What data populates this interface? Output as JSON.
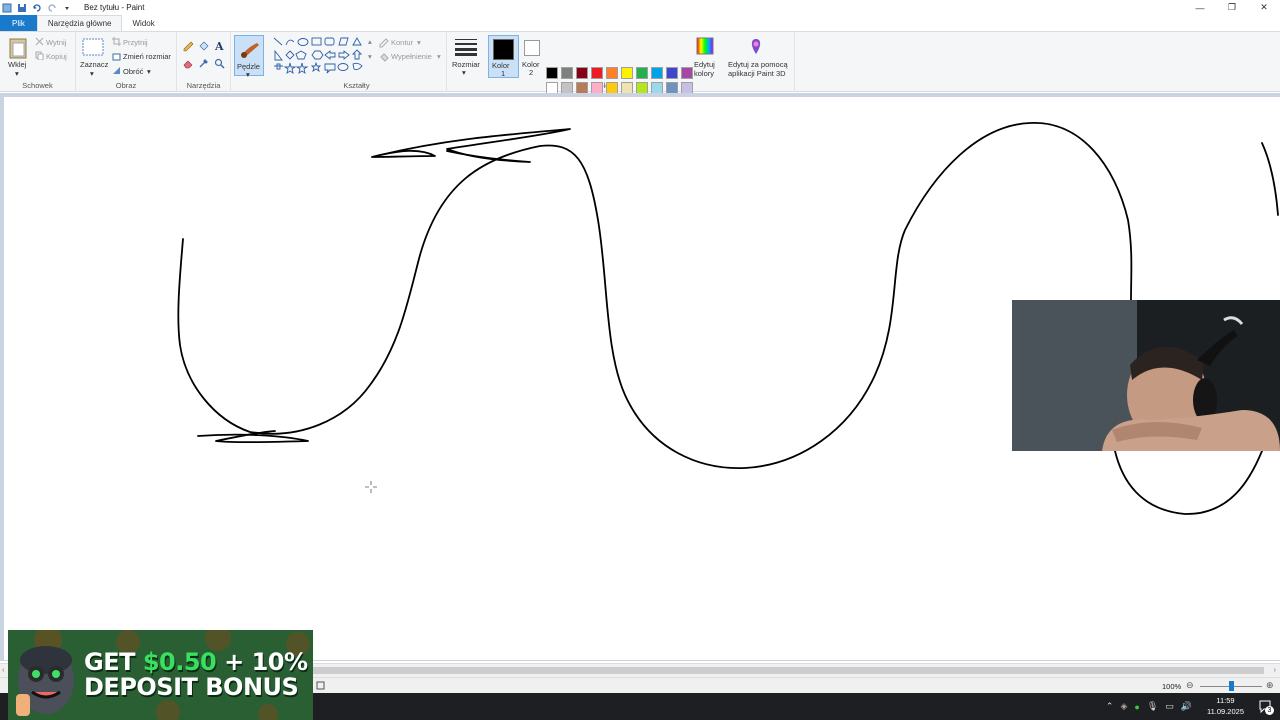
{
  "window": {
    "title": "Bez tytułu - Paint",
    "minimize_icon": "minimize-icon",
    "maximize_icon": "restore-icon",
    "close_icon": "close-icon"
  },
  "tabs": [
    {
      "label": "Plik"
    },
    {
      "label": "Narzędzia główne"
    },
    {
      "label": "Widok"
    }
  ],
  "ribbon": {
    "clipboard": {
      "group": "Schowek",
      "paste": "Wklej",
      "cut": "Wytnij",
      "copy": "Kopiuj"
    },
    "image": {
      "group": "Obraz",
      "select": "Zaznacz",
      "crop": "Przytnij",
      "resize": "Zmień rozmiar",
      "rotate": "Obróć"
    },
    "tools": {
      "group": "Narzędzia"
    },
    "brushes": {
      "label": "Pędzle"
    },
    "shapes": {
      "group": "Kształty",
      "outline": "Kontur",
      "fill": "Wypełnienie"
    },
    "size": {
      "label": "Rozmiar"
    },
    "colors": {
      "group": "Kolory",
      "color1": "Kolor",
      "color1_num": "1",
      "color2": "Kolor",
      "color2_num": "2",
      "edit": "Edytuj",
      "edit2": "kolory",
      "paint3d": "Edytuj za pomocą",
      "paint3d2": "aplikacji Paint 3D",
      "color1_value": "#000000",
      "color2_value": "#ffffff",
      "palette": [
        "#000000",
        "#7f7f7f",
        "#880015",
        "#ed1c24",
        "#ff7f27",
        "#fff200",
        "#22b14c",
        "#00a2e8",
        "#3f48cc",
        "#a349a4",
        "#ffffff",
        "#c3c3c3",
        "#b97a57",
        "#ffaec9",
        "#ffc90e",
        "#efe4b0",
        "#b5e61d",
        "#99d9ea",
        "#7092be",
        "#c8bfe7"
      ]
    }
  },
  "status": {
    "zoom": "100%"
  },
  "taskbar": {
    "time": "11:59",
    "date": "11.09.2025",
    "notifications": "3"
  },
  "banner": {
    "line1_a": "GET ",
    "line1_b": "$0.50",
    "line1_c": " + 10%",
    "line2": "DEPOSIT BONUS"
  }
}
